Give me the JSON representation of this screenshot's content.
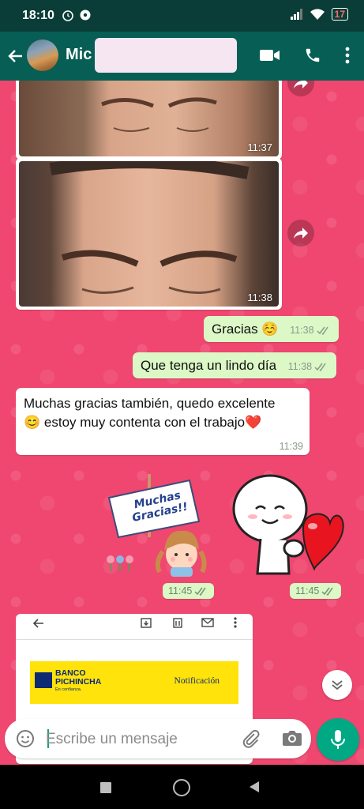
{
  "status_bar": {
    "time": "18:10",
    "battery": "17"
  },
  "header": {
    "contact_name": "Mic"
  },
  "messages": {
    "photo1_time": "11:37",
    "photo2_time": "11:38",
    "out1": {
      "text": "Gracias ☺️",
      "time": "11:38"
    },
    "out2": {
      "text": "Que tenga un lindo día",
      "time": "11:38"
    },
    "in1": {
      "line1": "Muchas gracias también, quedo excelente",
      "line2": "😊 estoy muy contenta con el trabajo❤️",
      "time": "11:39"
    },
    "sticker1": {
      "sign_line1": "Muchas",
      "sign_line2": "Gracias!!",
      "time": "11:45"
    },
    "sticker2": {
      "time": "11:45"
    }
  },
  "document": {
    "bank_name_line1": "BANCO",
    "bank_name_line2": "PICHINCHA",
    "bank_tagline": "En confianza.",
    "notification": "Notificación"
  },
  "input": {
    "placeholder": "Escribe un mensaje"
  },
  "colors": {
    "header": "#075e54",
    "chat_bg": "#ef476f",
    "outgoing": "#dcf8c6",
    "accent": "#00a884",
    "bank_yellow": "#ffe30a"
  },
  "icons": [
    "back-arrow-icon",
    "video-call-icon",
    "phone-icon",
    "more-vert-icon",
    "forward-icon",
    "double-check-icon",
    "emoji-icon",
    "attach-icon",
    "camera-icon",
    "mic-icon",
    "chevron-double-down-icon"
  ]
}
